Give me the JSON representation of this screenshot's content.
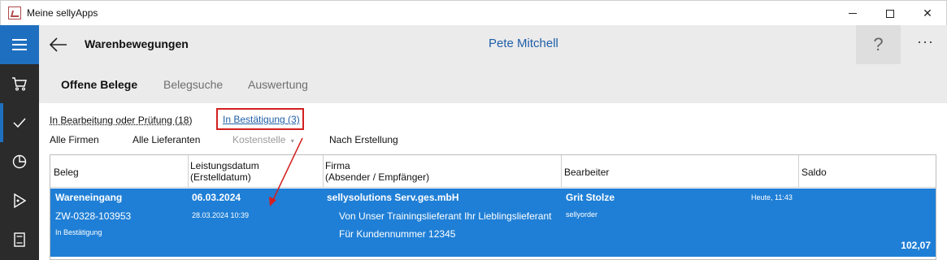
{
  "window": {
    "title": "Meine sellyApps",
    "minimize_label": "",
    "close_label": "✕"
  },
  "header": {
    "title": "Warenbewegungen",
    "user": "Pete Mitchell",
    "help_label": "?",
    "more_label": "···"
  },
  "tabs": [
    {
      "label": "Offene Belege",
      "active": true
    },
    {
      "label": "Belegsuche",
      "active": false
    },
    {
      "label": "Auswertung",
      "active": false
    }
  ],
  "filters": {
    "status_in_progress": "In Bearbeitung oder Prüfung (18)",
    "status_confirmation": "In Bestätigung (3)",
    "companies": "Alle Firmen",
    "suppliers": "Alle Lieferanten",
    "cost_center": "Kostenstelle",
    "cost_center_caret": "▾",
    "sort": "Nach Erstellung"
  },
  "table": {
    "columns": {
      "beleg": "Beleg",
      "datum_line1": "Leistungsdatum",
      "datum_line2": "(Erstelldatum)",
      "firma_line1": "Firma",
      "firma_line2": "(Absender / Empfänger)",
      "bearbeiter": "Bearbeiter",
      "saldo": "Saldo"
    },
    "rows": [
      {
        "type": "Wareneingang",
        "number": "ZW-0328-103953",
        "status": "In Bestätigung",
        "service_date": "06.03.2024",
        "created": "28.03.2024 10:39",
        "company": "sellysolutions Serv.ges.mbH",
        "from": "Von  Unser Trainingslieferant Ihr Lieblingslieferant",
        "customer_no": "Für Kundennummer  12345",
        "editor": "Grit Stolze",
        "editor_time": "Heute, 11:43",
        "editor_source": "sellyorder",
        "balance": "102,07"
      }
    ]
  },
  "colors": {
    "accent": "#1f6fc0",
    "selected_row": "#1f7fd6",
    "rail": "#2b2b2b",
    "header_bg": "#ebebeb",
    "annotation": "#d32020"
  }
}
